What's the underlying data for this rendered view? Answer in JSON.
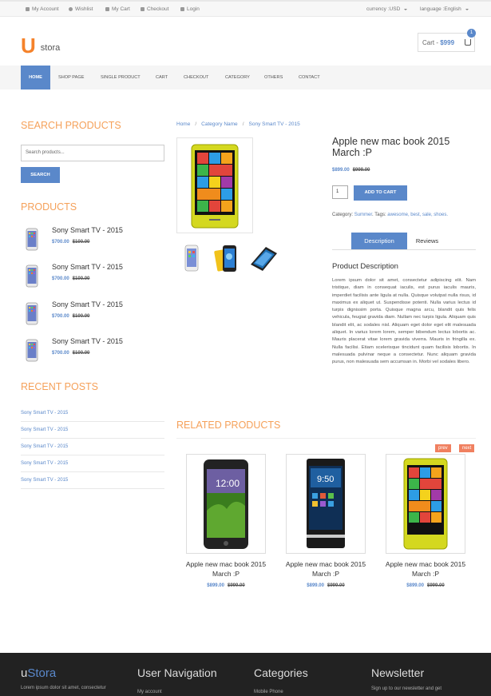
{
  "topbar": {
    "links": [
      "My Account",
      "Wishlist",
      "My Cart",
      "Checkout",
      "Login"
    ],
    "currency": "currency :USD",
    "language": "language :English"
  },
  "header": {
    "logo_u": "U",
    "logo_text": "stora",
    "cart_label": "Cart - ",
    "cart_amount": "$999",
    "cart_count": "1"
  },
  "nav": [
    "HOME",
    "SHOP PAGE",
    "SINGLE PRODUCT",
    "CART",
    "CHECKOUT",
    "CATEGORY",
    "OTHERS",
    "CONTACT"
  ],
  "sidebar": {
    "search_heading": "SEARCH PRODUCTS",
    "search_placeholder": "Search products...",
    "search_button": "SEARCH",
    "products_heading": "PRODUCTS",
    "products": [
      {
        "name": "Sony Smart TV - 2015",
        "price": "$700.00",
        "old": "$100.00"
      },
      {
        "name": "Sony Smart TV - 2015",
        "price": "$700.00",
        "old": "$100.00"
      },
      {
        "name": "Sony Smart TV - 2015",
        "price": "$700.00",
        "old": "$100.00"
      },
      {
        "name": "Sony Smart TV - 2015",
        "price": "$700.00",
        "old": "$100.00"
      }
    ],
    "posts_heading": "RECENT POSTS",
    "posts": [
      "Sony Smart TV - 2015",
      "Sony Smart TV - 2015",
      "Sony Smart TV - 2015",
      "Sony Smart TV - 2015",
      "Sony Smart TV - 2015"
    ]
  },
  "breadcrumb": [
    "Home",
    "Category Name",
    "Sony Smart TV - 2015"
  ],
  "product": {
    "title": "Apple new mac book 2015 March :P",
    "price": "$899.00",
    "old_price": "$999.00",
    "qty": "1",
    "add_to_cart": "ADD TO CART",
    "category_label": "Category:",
    "category": "Summer",
    "tags_label": "Tags:",
    "tags": "awesome, best, sale, shoes.",
    "tab_description": "Description",
    "tab_reviews": "Reviews",
    "desc_heading": "Product Description",
    "desc_text": "Lorem ipsum dolor sit amet, consectetur adipiscing elit. Nam tristique, diam in consequat iaculis, est purus iaculis mauris, imperdiet facilisis ante ligula at nulla. Quisque volutpat nulla risus, id maximus ex aliquet ut. Suspendisse potenti. Nulla varius lectus id turpis dignissim porta. Quisque magna arcu, blandit quis felis vehicula, feugiat gravida diam. Nullam nec turpis ligula. Aliquam quis blandit elit, ac sodales nisl. Aliquam eget dolor eget elit malesuada aliquet. In varius lorem lorem, semper bibendum lectus lobortis ac. Mauris placerat vitae lorem gravida viverra. Mauris in fringilla ex. Nulla facilisi. Etiam scelerisque tincidunt quam facilisis lobortis. In malesuada pulvinar neque a consectetur. Nunc aliquam gravida purus, non malesuada sem accumsan in. Morbi vel sodales libero."
  },
  "related": {
    "heading": "RELATED PRODUCTS",
    "prev": "prev",
    "next": "next",
    "items": [
      {
        "name": "Apple new mac book 2015 March :P",
        "price": "$899.00",
        "old": "$999.00"
      },
      {
        "name": "Apple new mac book 2015 March :P",
        "price": "$899.00",
        "old": "$999.00"
      },
      {
        "name": "Apple new mac book 2015 March :P",
        "price": "$899.00",
        "old": "$999.00"
      }
    ]
  },
  "footer": {
    "brand_u": "u",
    "brand_rest": "Stora",
    "about": "Lorem ipsum dolor sit amet, consectetur",
    "nav_heading": "User Navigation",
    "nav_first": "My account",
    "cat_heading": "Categories",
    "cat_first": "Mobile Phone",
    "news_heading": "Newsletter",
    "news_text": "Sign up to our newsletter and get"
  }
}
